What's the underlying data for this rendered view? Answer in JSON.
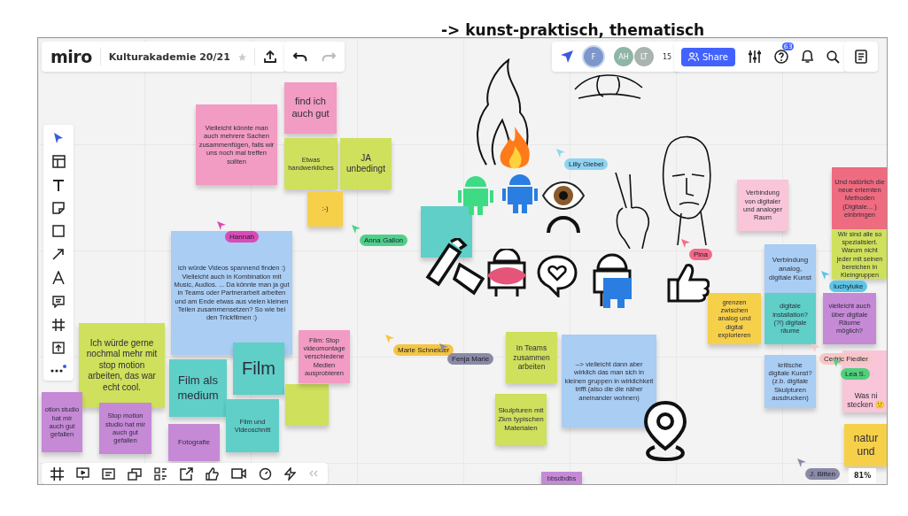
{
  "board_heading": "-> kunst-praktisch, thematisch",
  "top_bar": {
    "logo": "miro",
    "board_name": "Kulturakademie 20/21",
    "collaborator_avatars": [
      "F",
      "AH",
      "LT"
    ],
    "collaborator_count": "15",
    "share_button": "Share",
    "help_badge": "63"
  },
  "sticky_notes": [
    {
      "text": "Vielleicht könnte man auch mehrere Sachen zusammenfügen, falls wir uns noch mal treffen sollten",
      "color": "#f29bc3"
    },
    {
      "text": "find ich auch gut",
      "color": "#f29bc3"
    },
    {
      "text": "Etwas handwerkliches",
      "color": "#cfe05c"
    },
    {
      "text": "JA unbedingt",
      "color": "#cfe05c"
    },
    {
      "text": ":-)",
      "color": "#f7d04a"
    },
    {
      "text": "ich würde Videos spannend finden :) Vielleicht auch in Kombination mit Music, Audios. ... Da könnte man ja gut in Teams oder Partnerarbeit arbeiten und am Ende etwas aus vielen kleinen Teilen zusammensetzen? So wie bei den Trickfilmen :)",
      "color": "#a9cdf3"
    },
    {
      "text": "Ich würde gerne nochmal mehr mit stop motion arbeiten, das war echt cool.",
      "color": "#cfe05c"
    },
    {
      "text": "Film als medium",
      "color": "#5fcfc8"
    },
    {
      "text": "Film",
      "color": "#5fcfc8"
    },
    {
      "color": "#cfe05c"
    },
    {
      "text": "Film und Videoschnitt",
      "color": "#5fcfc8"
    },
    {
      "text": "Film: Stop videomontage verschiedene Medien ausprobieren",
      "color": "#f29bc3"
    },
    {
      "text": "otion studio hat mir auch gut gefallen",
      "color": "#c589d6"
    },
    {
      "text": "Stop motion studio hat mir auch gut gefallen",
      "color": "#c589d6"
    },
    {
      "text": "Fotografie",
      "color": "#c589d6"
    },
    {
      "text": "bbsdbdbs",
      "color": "#c589d6"
    },
    {
      "text": "In Teams zusammen arbeiten",
      "color": "#cfe05c"
    },
    {
      "text": "Skulpturen mit Zkm typischen Materialen",
      "color": "#cfe05c"
    },
    {
      "text": "--> vielleicht dann aber wirklich das man sich in kleinen gruppen in wirklichkeit trifft (also die die näher aneinander wohnen)",
      "color": "#a9cdf3"
    },
    {
      "color": "#5fcfc8"
    },
    {
      "text": "Verbindung von digitaler und analoger Raum",
      "color": "#f9c5d8"
    },
    {
      "text": "Und natürlich die neue erlernten Methoden (Digitale... ) einbringen",
      "color": "#ef6b80"
    },
    {
      "text": "Verbindung analog, digitale Kunst",
      "color": "#a9cdf3"
    },
    {
      "text": "Wir sind alle so spezialisiert. Warum nicht jeder mit seinen bereichen in Kleingruppen",
      "color": "#cfe05c"
    },
    {
      "text": "grenzen zwischen analog und digital explorieren",
      "color": "#f7d04a"
    },
    {
      "text": "digitale installation? (?!) digitale räume",
      "color": "#5fcfc8"
    },
    {
      "text": "vielleicht auch über digitale Räume möglich?",
      "color": "#c589d6"
    },
    {
      "text": "kritische digitale Kunst? (z.b. digitale Skulpturen ausdrucken)",
      "color": "#a9cdf3"
    },
    {
      "text": "Was ni stecken 🙂",
      "color": "#f9c5d8"
    },
    {
      "text": "natur und",
      "color": "#f7d04a"
    }
  ],
  "cursors": [
    {
      "name": "Hannah",
      "color": "#d94bb8"
    },
    {
      "name": "Anna Gallon",
      "color": "#4fd08a"
    },
    {
      "name": "Lilly Giebel",
      "color": "#8fd4f0"
    },
    {
      "name": "Pina",
      "color": "#f36a88"
    },
    {
      "name": "Marie Schneider",
      "color": "#f5c542"
    },
    {
      "name": "Fenja Marie",
      "color": "#8a8aa6"
    },
    {
      "name": "luchyluke",
      "color": "#5bc6e6"
    },
    {
      "name": "Cedric Fiedler",
      "color": "#f8c6c6"
    },
    {
      "name": "Lea S.",
      "color": "#4fd07a"
    },
    {
      "name": "J. Bitten",
      "color": "#8a8aa6"
    }
  ],
  "zoom_level": "81%"
}
